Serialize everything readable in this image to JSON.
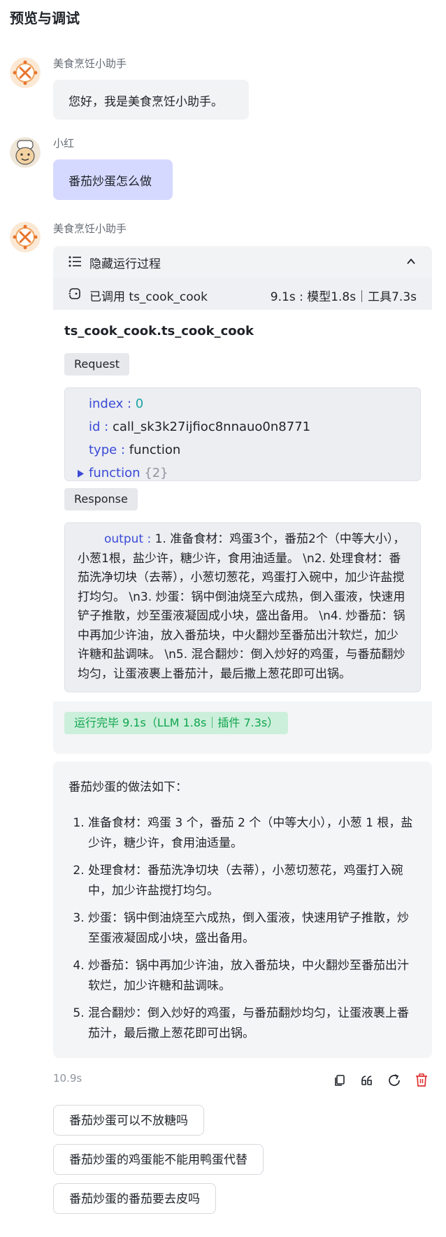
{
  "header": {
    "title": "预览与调试"
  },
  "messages": [
    {
      "sender": "美食烹饪小助手",
      "text": "您好，我是美食烹饪小助手。"
    },
    {
      "sender": "小红",
      "text": "番茄炒蛋怎么做"
    },
    {
      "sender": "美食烹饪小助手"
    }
  ],
  "run_panel": {
    "toggle_label": "隐藏运行过程",
    "toolcall_label": "已调用 ts_cook_cook",
    "toolcall_timing": "9.1s : 模型1.8s｜工具7.3s",
    "function_name": "ts_cook_cook.ts_cook_cook",
    "request_tag": "Request",
    "request": [
      {
        "key": "index :",
        "value": "0"
      },
      {
        "key": "id :",
        "value": "call_sk3k27ijfioc8nnauo0n8771"
      },
      {
        "key": "type :",
        "value": "function"
      },
      {
        "key": "function",
        "value": "{2}"
      }
    ],
    "response_tag": "Response",
    "response_key": "output :",
    "response_value": "1. 准备食材：鸡蛋3个，番茄2个（中等大小），小葱1根，盐少许，糖少许，食用油适量。 \\n2. 处理食材：番茄洗净切块（去蒂），小葱切葱花，鸡蛋打入碗中，加少许盐搅打均匀。 \\n3. 炒蛋：锅中倒油烧至六成热，倒入蛋液，快速用铲子推散，炒至蛋液凝固成小块，盛出备用。 \\n4. 炒番茄：锅中再加少许油，放入番茄块，中火翻炒至番茄出汁软烂，加少许糖和盐调味。 \\n5. 混合翻炒：倒入炒好的鸡蛋，与番茄翻炒均匀，让蛋液裹上番茄汁，最后撒上葱花即可出锅。",
    "status": "运行完毕 9.1s（LLM 1.8s｜插件 7.3s）"
  },
  "answer": {
    "intro": "番茄炒蛋的做法如下：",
    "steps": [
      "准备食材：鸡蛋 3 个，番茄 2 个（中等大小），小葱 1 根，盐少许，糖少许，食用油适量。",
      "处理食材：番茄洗净切块（去蒂），小葱切葱花，鸡蛋打入碗中，加少许盐搅打均匀。",
      "炒蛋：锅中倒油烧至六成热，倒入蛋液，快速用铲子推散，炒至蛋液凝固成小块，盛出备用。",
      "炒番茄：锅中再加少许油，放入番茄块，中火翻炒至番茄出汁软烂，加少许糖和盐调味。",
      "混合翻炒：倒入炒好的鸡蛋，与番茄翻炒均匀，让蛋液裹上番茄汁，最后撒上葱花即可出锅。"
    ]
  },
  "footer": {
    "elapsed": "10.9s"
  },
  "suggestions": [
    "番茄炒蛋可以不放糖吗",
    "番茄炒蛋的鸡蛋能不能用鸭蛋代替",
    "番茄炒蛋的番茄要去皮吗"
  ],
  "colors": {
    "accent": "#3b4ad6",
    "user_bubble": "#d6d9ff",
    "status_green": "#10a64d",
    "delete_red": "#e02e2e"
  },
  "icons": [
    "bot-avatar",
    "user-avatar",
    "list-icon",
    "chevron-up-icon",
    "plugin-icon",
    "caret-right-icon",
    "copy-icon",
    "quote-icon",
    "refresh-icon",
    "delete-icon"
  ]
}
